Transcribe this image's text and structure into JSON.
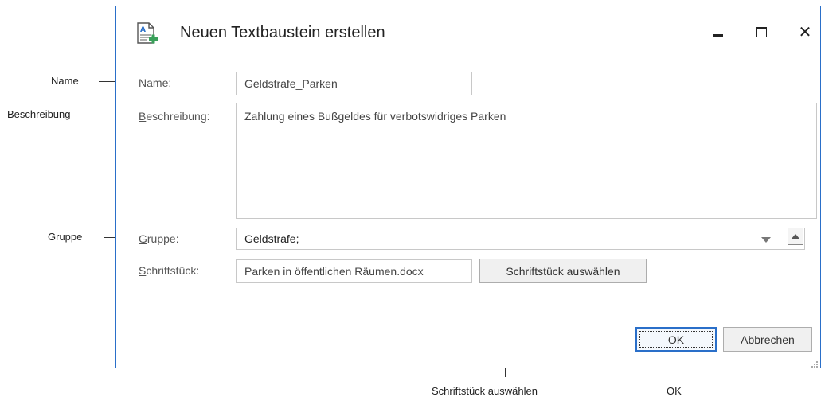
{
  "callouts": {
    "name": "Name",
    "description": "Beschreibung",
    "group": "Gruppe",
    "select_document": "Schriftstück auswählen",
    "ok": "OK"
  },
  "dialog": {
    "title": "Neuen Textbaustein erstellen",
    "title_icon": "new-text-module-icon",
    "controls": {
      "minimize": "minimize-icon",
      "maximize": "maximize-icon",
      "close": "close-icon",
      "close_glyph": "✕"
    }
  },
  "form": {
    "name": {
      "label_mnemonic": "N",
      "label_rest": "ame:",
      "value": "Geldstrafe_Parken"
    },
    "description": {
      "label_mnemonic": "B",
      "label_rest": "eschreibung:",
      "value": "Zahlung eines Bußgeldes für verbotswidriges Parken"
    },
    "group": {
      "label_mnemonic": "G",
      "label_rest": "ruppe:",
      "value": "Geldstrafe;"
    },
    "document": {
      "label_mnemonic": "S",
      "label_rest": "chriftstück:",
      "value": "Parken in öffentlichen Räumen.docx"
    }
  },
  "buttons": {
    "select_document": "Schriftstück auswählen",
    "ok_mnemonic": "O",
    "ok_rest": "K",
    "cancel_mnemonic": "A",
    "cancel_rest": "bbrechen"
  },
  "colors": {
    "accent": "#2a6fc9",
    "field_border": "#c8c8c8",
    "button_face": "#f0f0f0"
  }
}
